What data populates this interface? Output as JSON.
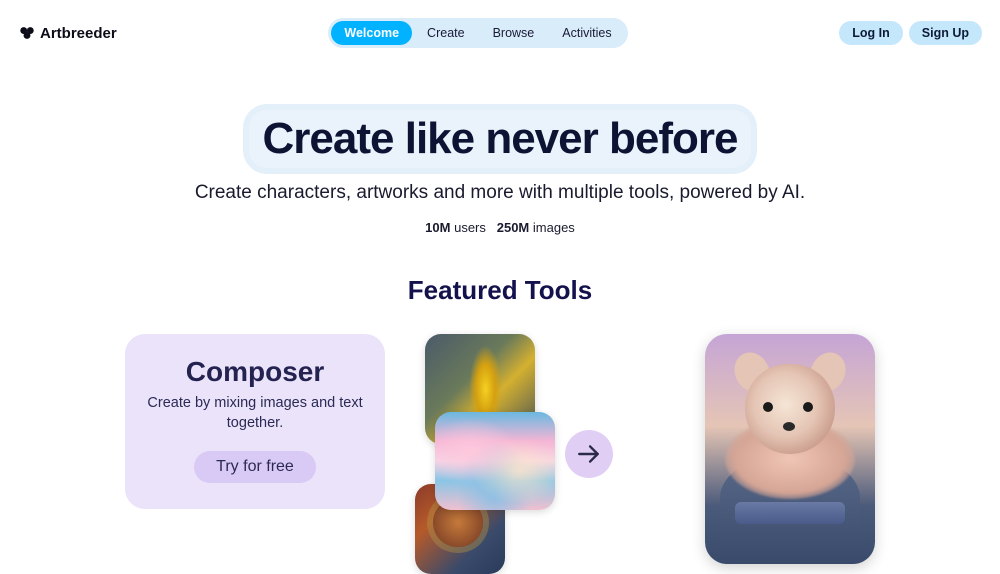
{
  "brand": {
    "name": "Artbreeder"
  },
  "nav": {
    "items": [
      {
        "label": "Welcome",
        "active": true
      },
      {
        "label": "Create",
        "active": false
      },
      {
        "label": "Browse",
        "active": false
      },
      {
        "label": "Activities",
        "active": false
      }
    ]
  },
  "auth": {
    "login": "Log In",
    "signup": "Sign Up"
  },
  "hero": {
    "title": "Create like never before",
    "subtitle": "Create characters, artworks and more with multiple tools, powered by AI.",
    "stats": {
      "users_value": "10M",
      "users_label": "users",
      "images_value": "250M",
      "images_label": "images"
    }
  },
  "featured": {
    "heading": "Featured Tools",
    "composer": {
      "title": "Composer",
      "description": "Create by mixing images and text together.",
      "cta": "Try for free"
    },
    "cluster": {
      "img1": "golden-wings-painting",
      "img2": "pastel-clouds",
      "img3": "fantasy-warrior",
      "arrow": "arrow-right-icon",
      "result": "fluffy-dog-fantasy-portrait"
    }
  }
}
